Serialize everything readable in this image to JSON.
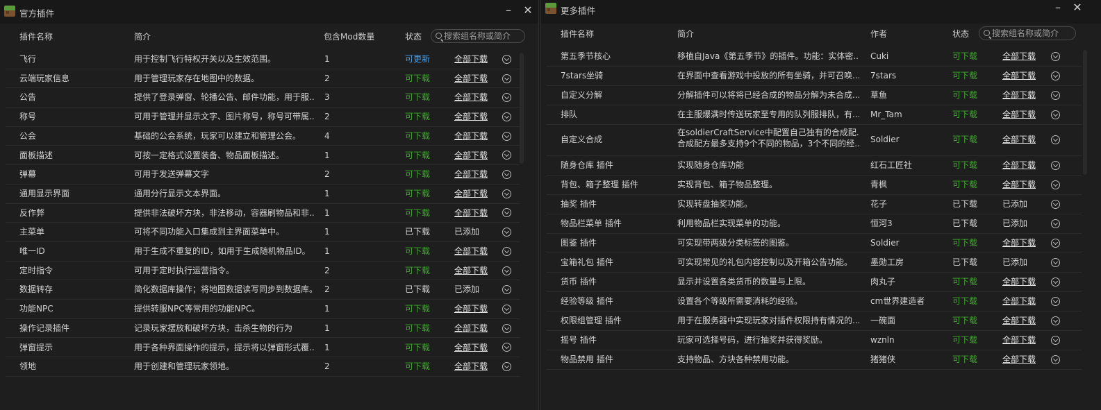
{
  "left": {
    "title": "官方插件",
    "columns": {
      "name": "插件名称",
      "desc": "简介",
      "count": "包含Mod数量",
      "status": "状态"
    },
    "search_placeholder": "搜索组名称或简介",
    "rows": [
      {
        "name": "飞行",
        "desc": "用于控制飞行特权开关以及生效范围。",
        "count": "1",
        "status": "可更新",
        "status_type": "update",
        "action": "全部下载",
        "action_type": "link"
      },
      {
        "name": "云端玩家信息",
        "desc": "用于管理玩家存在地图中的数据。",
        "count": "2",
        "status": "可下载",
        "status_type": "download",
        "action": "全部下载",
        "action_type": "link"
      },
      {
        "name": "公告",
        "desc": "提供了登录弹窗、轮播公告、邮件功能，用于服...",
        "count": "3",
        "status": "可下载",
        "status_type": "download",
        "action": "全部下载",
        "action_type": "link"
      },
      {
        "name": "称号",
        "desc": "可用于管理并显示文字、图片称号，称号可带属...",
        "count": "2",
        "status": "可下载",
        "status_type": "download",
        "action": "全部下载",
        "action_type": "link"
      },
      {
        "name": "公会",
        "desc": "基础的公会系统，玩家可以建立和管理公会。",
        "count": "4",
        "status": "可下载",
        "status_type": "download",
        "action": "全部下载",
        "action_type": "link"
      },
      {
        "name": "面板描述",
        "desc": "可按一定格式设置装备、物品面板描述。",
        "count": "1",
        "status": "可下载",
        "status_type": "download",
        "action": "全部下载",
        "action_type": "link"
      },
      {
        "name": "弹幕",
        "desc": "可用于发送弹幕文字",
        "count": "2",
        "status": "可下载",
        "status_type": "download",
        "action": "全部下载",
        "action_type": "link"
      },
      {
        "name": "通用显示界面",
        "desc": "通用分行显示文本界面。",
        "count": "1",
        "status": "可下载",
        "status_type": "download",
        "action": "全部下载",
        "action_type": "link"
      },
      {
        "name": "反作弊",
        "desc": "提供非法破坏方块，非法移动，容器刷物品和非...",
        "count": "1",
        "status": "可下载",
        "status_type": "download",
        "action": "全部下载",
        "action_type": "link"
      },
      {
        "name": "主菜单",
        "desc": "可将不同功能入口集成到主界面菜单中。",
        "count": "1",
        "status": "已下载",
        "status_type": "downloaded",
        "action": "已添加",
        "action_type": "added"
      },
      {
        "name": "唯一ID",
        "desc": "用于生成不重复的ID，如用于生成随机物品ID。",
        "count": "1",
        "status": "可下载",
        "status_type": "download",
        "action": "全部下载",
        "action_type": "link"
      },
      {
        "name": "定时指令",
        "desc": "可用于定时执行运营指令。",
        "count": "2",
        "status": "可下载",
        "status_type": "download",
        "action": "全部下载",
        "action_type": "link"
      },
      {
        "name": "数据转存",
        "desc": "简化数据库操作；将地图数据读写同步到数据库。",
        "count": "2",
        "status": "已下载",
        "status_type": "downloaded",
        "action": "已添加",
        "action_type": "added"
      },
      {
        "name": "功能NPC",
        "desc": "提供转服NPC等常用的功能NPC。",
        "count": "1",
        "status": "可下载",
        "status_type": "download",
        "action": "全部下载",
        "action_type": "link"
      },
      {
        "name": "操作记录插件",
        "desc": "记录玩家摆放和破坏方块，击杀生物的行为",
        "count": "1",
        "status": "可下载",
        "status_type": "download",
        "action": "全部下载",
        "action_type": "link"
      },
      {
        "name": "弹窗提示",
        "desc": "用于各种界面操作的提示，提示将以弹窗形式覆...",
        "count": "1",
        "status": "可下载",
        "status_type": "download",
        "action": "全部下载",
        "action_type": "link"
      },
      {
        "name": "领地",
        "desc": "用于创建和管理玩家领地。",
        "count": "2",
        "status": "可下载",
        "status_type": "download",
        "action": "全部下载",
        "action_type": "link"
      }
    ]
  },
  "right": {
    "title": "更多插件",
    "columns": {
      "name": "插件名称",
      "desc": "简介",
      "author": "作者",
      "status": "状态"
    },
    "search_placeholder": "搜索组名称或简介",
    "rows": [
      {
        "name": "第五季节核心",
        "desc": "移植自Java《第五季节》的插件。功能：实体密...",
        "author": "Cuki",
        "status": "可下载",
        "status_type": "download",
        "action": "全部下载",
        "action_type": "link"
      },
      {
        "name": "7stars坐骑",
        "desc": "在界面中查看游戏中投放的所有坐骑，并可召唤...",
        "author": "7stars",
        "status": "可下载",
        "status_type": "download",
        "action": "全部下载",
        "action_type": "link"
      },
      {
        "name": "自定义分解",
        "desc": "分解插件可以将将已经合成的物品分解为未合成...",
        "author": "草鱼",
        "status": "可下载",
        "status_type": "download",
        "action": "全部下载",
        "action_type": "link"
      },
      {
        "name": "排队",
        "desc": "在主服爆满时传送玩家至专用的队列服排队，有...",
        "author": "Mr_Tam",
        "status": "可下载",
        "status_type": "download",
        "action": "全部下载",
        "action_type": "link"
      },
      {
        "name": "自定义合成",
        "desc": "在soldierCraftService中配置自己独有的合成配...",
        "desc2": "合成配方最多支持9个不同的物品，3个不同的经...",
        "author": "Soldier",
        "status": "可下载",
        "status_type": "download",
        "action": "全部下载",
        "action_type": "link"
      },
      {
        "name": "随身仓库 插件",
        "desc": "实现随身仓库功能",
        "author": "红石工匠社",
        "status": "可下载",
        "status_type": "download",
        "action": "全部下载",
        "action_type": "link"
      },
      {
        "name": "背包、箱子整理 插件",
        "desc": "实现背包、箱子物品整理。",
        "author": "青枫",
        "status": "可下载",
        "status_type": "download",
        "action": "全部下载",
        "action_type": "link"
      },
      {
        "name": "抽奖 插件",
        "desc": "实现转盘抽奖功能。",
        "author": "花子",
        "status": "已下载",
        "status_type": "downloaded",
        "action": "已添加",
        "action_type": "added"
      },
      {
        "name": "物品栏菜单 插件",
        "desc": "利用物品栏实现菜单的功能。",
        "author": "恒河3",
        "status": "已下载",
        "status_type": "downloaded",
        "action": "已添加",
        "action_type": "added"
      },
      {
        "name": "图鉴 插件",
        "desc": "可实现带两级分类标签的图鉴。",
        "author": "Soldier",
        "status": "可下载",
        "status_type": "download",
        "action": "全部下载",
        "action_type": "link"
      },
      {
        "name": "宝箱礼包 插件",
        "desc": "可实现常见的礼包内容控制以及开箱公告功能。",
        "author": "墨勋工房",
        "status": "已下载",
        "status_type": "downloaded",
        "action": "已添加",
        "action_type": "added"
      },
      {
        "name": "货币 插件",
        "desc": "显示并设置各类货币的数量与上限。",
        "author": "肉丸子",
        "status": "可下载",
        "status_type": "download",
        "action": "全部下载",
        "action_type": "link"
      },
      {
        "name": "经验等级 插件",
        "desc": "设置各个等级所需要消耗的经验。",
        "author": "cm世界建造者",
        "status": "可下载",
        "status_type": "download",
        "action": "全部下载",
        "action_type": "link"
      },
      {
        "name": "权限组管理 插件",
        "desc": "用于在服务器中实现玩家对插件权限持有情况的...",
        "author": "一碗面",
        "status": "可下载",
        "status_type": "download",
        "action": "全部下载",
        "action_type": "link"
      },
      {
        "name": "摇号 插件",
        "desc": "玩家可选择号码，进行抽奖并获得奖励。",
        "author": "wznln",
        "status": "可下载",
        "status_type": "download",
        "action": "全部下载",
        "action_type": "link"
      },
      {
        "name": "物品禁用 插件",
        "desc": "支持物品、方块各种禁用功能。",
        "author": "猪猪侠",
        "status": "可下载",
        "status_type": "download",
        "action": "全部下载",
        "action_type": "link"
      }
    ]
  }
}
